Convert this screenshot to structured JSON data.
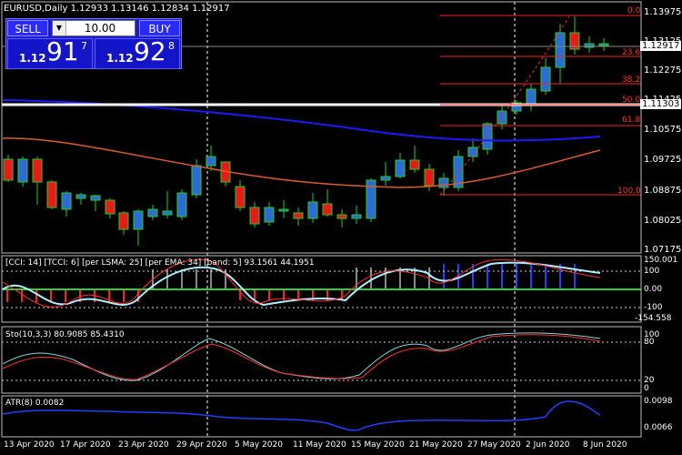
{
  "window": {
    "symbol_info": "EURUSD,Daily  1.12933 1.13146 1.12834 1.12917"
  },
  "trade_panel": {
    "sell_label": "SELL",
    "buy_label": "BUY",
    "volume": "10.00",
    "sell_price_prefix": "1.12",
    "sell_price_big": "91",
    "sell_price_sup": "7",
    "buy_price_prefix": "1.12",
    "buy_price_big": "92",
    "buy_price_sup": "8"
  },
  "price_axis": {
    "ticks": [
      "1.13975",
      "1.13125",
      "1.12275",
      "1.11425",
      "1.10575",
      "1.09725",
      "1.08875",
      "1.08025",
      "1.07175"
    ],
    "current_price_label": "1.12917",
    "line_label": "1.11303"
  },
  "fibonacci": {
    "levels": [
      "0.0",
      "23.6",
      "38.2",
      "50.0",
      "61.8",
      "100.0"
    ]
  },
  "cci_panel": {
    "header": "[CCI: 14] [TCCI: 6] [per LSMA: 25] [per EMA: 34] [band: 5]  93.1561 44.1951",
    "ticks": [
      "150.001",
      "100",
      "0.00",
      "-100",
      "-154.558"
    ]
  },
  "sto_panel": {
    "header": "Sto(10,3,3) 80.9085 85.4310",
    "ticks": [
      "100",
      "80",
      "20",
      "0"
    ]
  },
  "atr_panel": {
    "header": "ATR(8) 0.0082",
    "ticks": [
      "0.0098",
      "0.0066"
    ]
  },
  "time_axis": [
    "13 Apr 2020",
    "17 Apr 2020",
    "23 Apr 2020",
    "29 Apr 2020",
    "5 May 2020",
    "11 May 2020",
    "15 May 2020",
    "21 May 2020",
    "27 May 2020",
    "2 Jun 2020",
    "8 Jun 2020"
  ],
  "colors": {
    "background": "#000000",
    "bull_candle": "#2f6bd6",
    "bear_candle": "#e81a1a",
    "wick": "#1fd01f",
    "ma_blue": "#1a1aff",
    "ma_red": "#e05a30",
    "fib": "#ff2020",
    "grid": "#ffffff"
  }
}
